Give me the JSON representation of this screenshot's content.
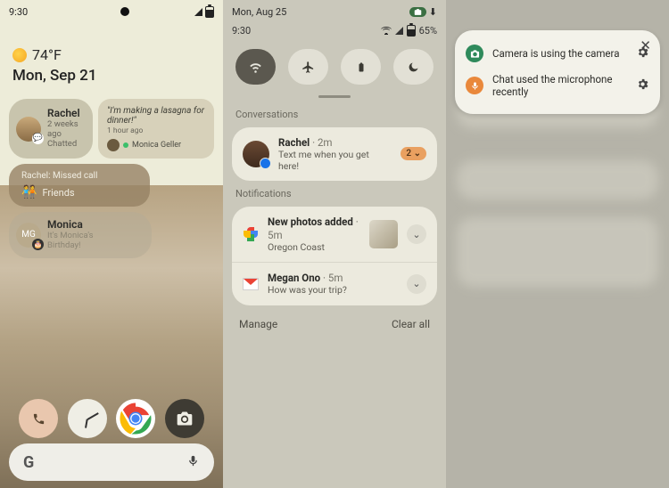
{
  "panel1": {
    "status": {
      "time": "9:30"
    },
    "weather": {
      "temp": "74°F"
    },
    "date": "Mon, Sep 21",
    "rachel": {
      "name": "Rachel",
      "sub1": "2 weeks ago",
      "sub2": "Chatted"
    },
    "quote": {
      "text": "\"I'm making a lasagna for dinner!\"",
      "time": "1 hour ago",
      "author": "Monica Geller"
    },
    "missed": {
      "title": "Rachel: Missed call",
      "group": "Friends"
    },
    "monica": {
      "initials": "MG",
      "name": "Monica",
      "line1": "It's Monica's",
      "line2": "Birthday!"
    },
    "search": {
      "logo": "G"
    }
  },
  "panel2": {
    "status": {
      "date": "Mon, Aug 25",
      "time": "9:30",
      "battery": "65%"
    },
    "sections": {
      "conversations": "Conversations",
      "notifications": "Notifications"
    },
    "rachel": {
      "name": "Rachel",
      "time": "2m",
      "msg": "Text me when you get here!",
      "count": "2"
    },
    "photos": {
      "title": "New photos added",
      "time": "5m",
      "sub": "Oregon Coast"
    },
    "gmail": {
      "title": "Megan Ono",
      "time": "5m",
      "sub": "How was your trip?"
    },
    "footer": {
      "manage": "Manage",
      "clear": "Clear all"
    }
  },
  "panel3": {
    "camera": "Camera is using the camera",
    "mic": "Chat used the microphone recently"
  }
}
